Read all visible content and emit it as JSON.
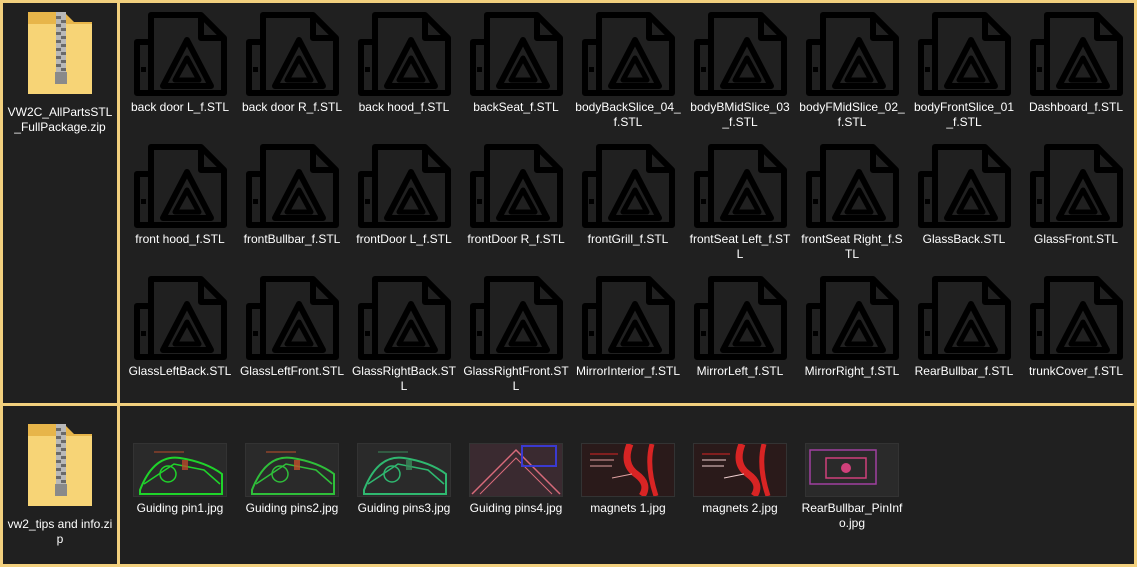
{
  "zip_files": [
    {
      "name": "VW2C_AllPartsSTL_FullPackage.zip",
      "icon": "zip-folder-icon"
    },
    {
      "name": "vw2_tips and info.zip",
      "icon": "zip-folder-icon"
    }
  ],
  "stl_files": [
    {
      "name": "back door L_f.STL"
    },
    {
      "name": "back door R_f.STL"
    },
    {
      "name": "back hood_f.STL"
    },
    {
      "name": "backSeat_f.STL"
    },
    {
      "name": "bodyBackSlice_04_f.STL"
    },
    {
      "name": "bodyBMidSlice_03_f.STL"
    },
    {
      "name": "bodyFMidSlice_02_f.STL"
    },
    {
      "name": "bodyFrontSlice_01_f.STL"
    },
    {
      "name": "Dashboard_f.STL"
    },
    {
      "name": "front hood_f.STL"
    },
    {
      "name": "frontBullbar_f.STL"
    },
    {
      "name": "frontDoor L_f.STL"
    },
    {
      "name": "frontDoor R_f.STL"
    },
    {
      "name": "frontGrill_f.STL"
    },
    {
      "name": "frontSeat Left_f.STL"
    },
    {
      "name": "frontSeat Right_f.STL"
    },
    {
      "name": "GlassBack.STL"
    },
    {
      "name": "GlassFront.STL"
    },
    {
      "name": "GlassLeftBack.STL"
    },
    {
      "name": "GlassLeftFront.STL"
    },
    {
      "name": "GlassRightBack.STL"
    },
    {
      "name": "GlassRightFront.STL"
    },
    {
      "name": "MirrorInterior_f.STL"
    },
    {
      "name": "MirrorLeft_f.STL"
    },
    {
      "name": "MirrorRight_f.STL"
    },
    {
      "name": "RearBullbar_f.STL"
    },
    {
      "name": "trunkCover_f.STL"
    }
  ],
  "image_files": [
    {
      "name": "Guiding pin1.jpg",
      "colors": [
        "#2a2a2a",
        "#1fd42a",
        "#b84a2a"
      ]
    },
    {
      "name": "Guiding pins2.jpg",
      "colors": [
        "#2a2a2a",
        "#2fbf3a",
        "#c0502a"
      ]
    },
    {
      "name": "Guiding pins3.jpg",
      "colors": [
        "#2a2a2a",
        "#2fb870",
        "#3a8a5a"
      ]
    },
    {
      "name": "Guiding pins4.jpg",
      "colors": [
        "#3a2a30",
        "#d86a7a",
        "#3a3ad0"
      ]
    },
    {
      "name": "magnets 1.jpg",
      "colors": [
        "#2a1a1a",
        "#d82424",
        "#e0a0a0"
      ]
    },
    {
      "name": "magnets 2.jpg",
      "colors": [
        "#2a1a1a",
        "#d82424",
        "#f0d0d0"
      ]
    },
    {
      "name": "RearBullbar_PinInfo.jpg",
      "colors": [
        "#2a2a2a",
        "#a040a0",
        "#d0407a"
      ]
    }
  ],
  "colors": {
    "background": "#202020",
    "divider": "#f2d07e",
    "text": "#ffffff",
    "icon_stroke": "#000000"
  }
}
